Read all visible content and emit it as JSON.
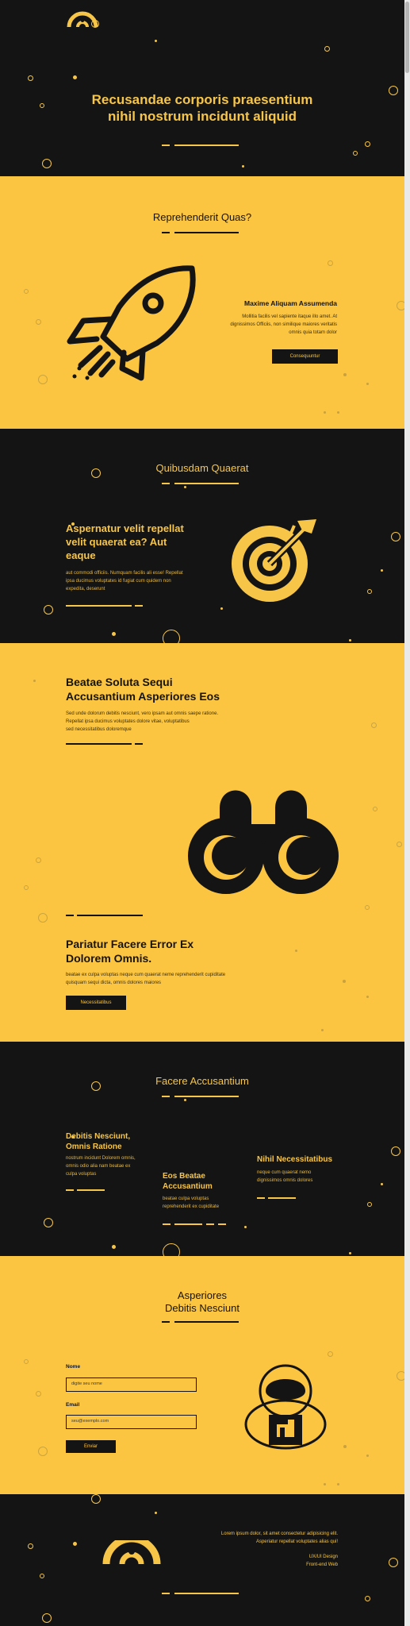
{
  "hero": {
    "title_line1": "Recusandae corporis praesentium",
    "title_line2": "nihil nostrum incidunt aliquid"
  },
  "section1": {
    "heading": "Reprehenderit Quas?",
    "card_title": "Maxime Aliquam Assumenda",
    "card_text_1": "Mollitia facilis vel sapiente itaque illo amet. At",
    "card_text_2": "dignissimos Officiis, non similique maiores veritatis",
    "card_text_3": "omnis quia totam dolor",
    "button_label": "Consequuntur",
    "icon": "rocket-icon"
  },
  "section2": {
    "heading": "Quibusdam Quaerat",
    "title_1": "Aspernatur velit repellat",
    "title_2": "velit quaerat ea? Aut",
    "title_3": "eaque",
    "text_1": "aut commodi officiis. Numquam facilis ali esse! Repellat",
    "text_2": "ipsa ducimus voluptates id fugiat cum quidem non",
    "text_3": "expedita, deserunt",
    "icon": "target-icon"
  },
  "section3": {
    "title_1": "Beatae Soluta Sequi",
    "title_2": "Accusantium Asperiores Eos",
    "text_1": "Sed unde dolorum debitis nesciunt, vero ipsam aut omnis saepe ratione.",
    "text_2": "Repellat ipsa ducimus voluptates dolore vitae, voluptatibus",
    "text_3": "sed necessitatibus doloremque",
    "title2_1": "Pariatur Facere Error Ex",
    "title2_2": "Dolorem Omnis.",
    "text2_1": "beatae ex culpa voluptas neque cum quaerat neme reprehenderit cupiditate",
    "text2_2": "quisquam sequi dicta, omnis dolores maiores",
    "button_label": "Necessitatibus",
    "icon": "binoculars-icon"
  },
  "section4": {
    "heading": "Facere Accusantium",
    "col1_title_1": "Debitis Nesciunt,",
    "col1_title_2": "Omnis Ratione",
    "col1_text_1": "nostrum incidunt Dolorem omnis,",
    "col1_text_2": "omnis odio alia nam beatae ex",
    "col1_text_3": "culpa voluptas",
    "col2_title_1": "Eos Beatae",
    "col2_title_2": "Accusantium",
    "col2_text_1": "beatae culpa voluptas",
    "col2_text_2": "reprehenderit ex cupiditate",
    "col3_title": "Nihil Necessitatibus",
    "col3_text_1": "neque cum quaerat nemo",
    "col3_text_2": "dignissimos omnis dolores"
  },
  "section5": {
    "heading_1": "Asperiores",
    "heading_2": "Debitis Nesciunt",
    "name_label": "Nome",
    "name_placeholder": "digite seu nome",
    "email_label": "Email",
    "email_placeholder": "seu@exemplo.com",
    "submit_label": "Enviar",
    "icon": "astronaut-icon"
  },
  "footer": {
    "text_1": "Lorem ipsum dolor, sit amet consectetur adipisicing elit.",
    "text_2": "Asperiatur repellat voluptates alias qui!",
    "role_1": "UX/UI Design",
    "role_2": "Front-end Web",
    "logo": "logo-icon"
  },
  "colors": {
    "dark": "#141414",
    "yellow": "#fcc541",
    "accent": "#f7c648"
  }
}
